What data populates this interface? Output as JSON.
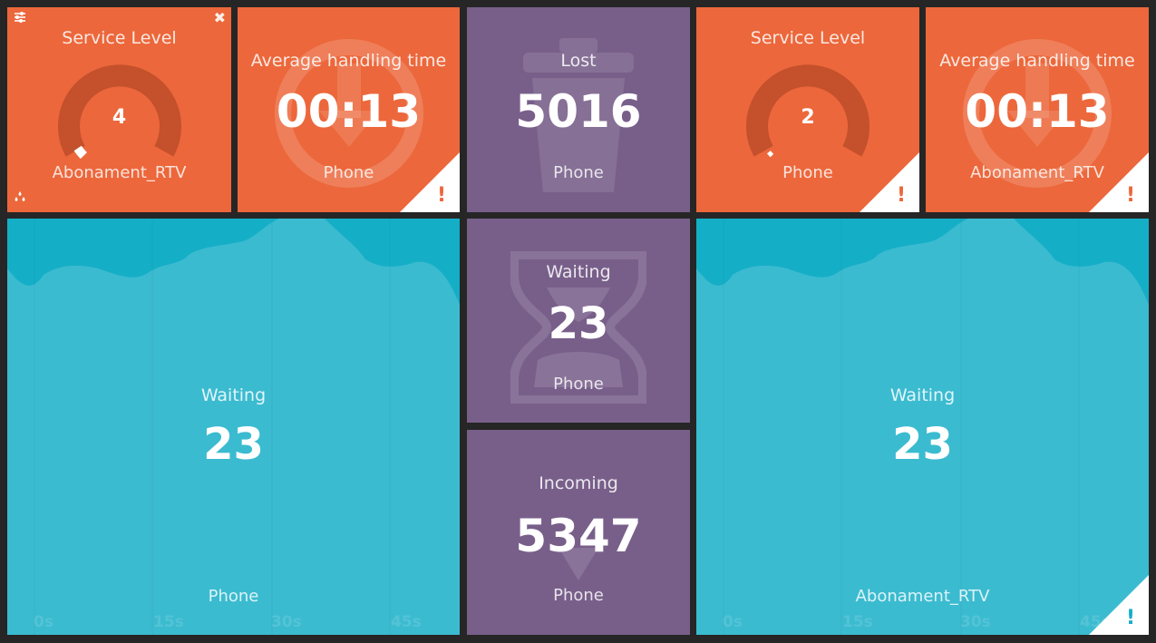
{
  "tiles": {
    "sl1": {
      "title": "Service Level",
      "value": "4",
      "queue": "Abonament_RTV",
      "gauge_fraction": 0.04
    },
    "aht1": {
      "title": "Average handling time",
      "value": "00:13",
      "queue": "Phone",
      "alert": "!"
    },
    "lost": {
      "title": "Lost",
      "value": "5016",
      "queue": "Phone"
    },
    "sl2": {
      "title": "Service Level",
      "value": "2",
      "queue": "Phone",
      "gauge_fraction": 0.02
    },
    "aht2": {
      "title": "Average handling time",
      "value": "00:13",
      "queue": "Abonament_RTV",
      "alert": "!"
    },
    "wait_left": {
      "title": "Waiting",
      "value": "23",
      "queue": "Phone",
      "ticks": [
        "0s",
        "15s",
        "30s",
        "45s"
      ]
    },
    "wait_mid": {
      "title": "Waiting",
      "value": "23",
      "queue": "Phone"
    },
    "incoming": {
      "title": "Incoming",
      "value": "5347",
      "queue": "Phone"
    },
    "wait_right": {
      "title": "Waiting",
      "value": "23",
      "queue": "Abonament_RTV",
      "ticks": [
        "0s",
        "15s",
        "30s",
        "45s"
      ],
      "alert": "!"
    }
  },
  "toolbar": {
    "settings_icon": "sliders-icon",
    "close_icon": "close-icon",
    "theme_icon": "drops-icon",
    "close_glyph": "✖"
  },
  "colors": {
    "orange": "#ec673b",
    "purple": "#785f8a",
    "cyan": "#3bbbd0",
    "gauge_track": "#c4502c",
    "background": "#262626"
  }
}
